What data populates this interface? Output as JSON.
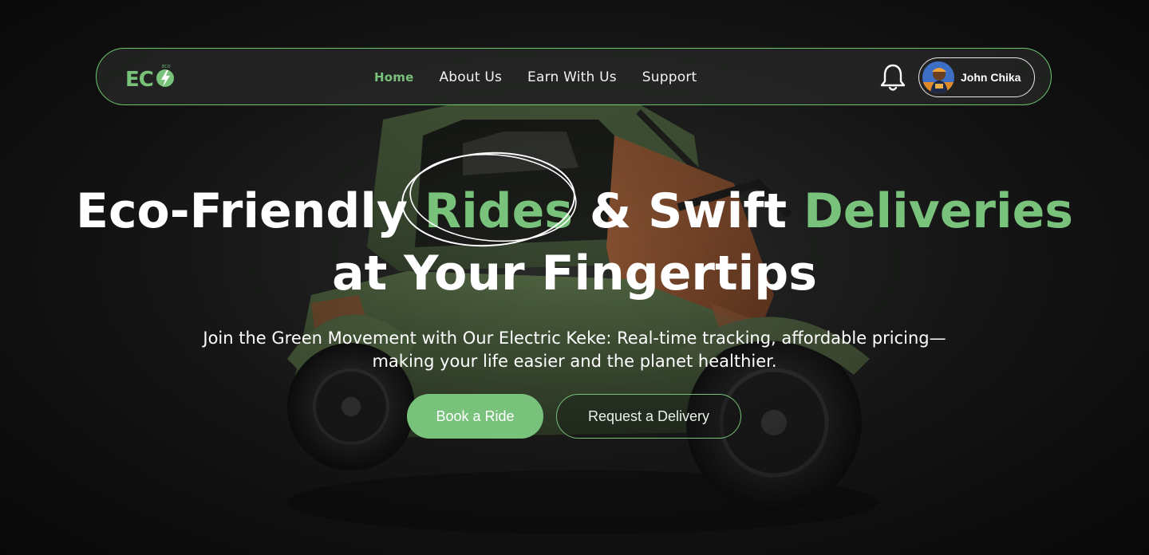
{
  "brand": {
    "logo_text": "ECO",
    "logo_icon": "lightning-bolt-icon",
    "accent_color": "#78c27b"
  },
  "nav": {
    "items": [
      {
        "label": "Home",
        "active": true
      },
      {
        "label": "About Us",
        "active": false
      },
      {
        "label": "Earn With Us",
        "active": false
      },
      {
        "label": "Support",
        "active": false
      }
    ]
  },
  "header_actions": {
    "notification_icon": "bell-icon",
    "user_name": "John Chika"
  },
  "hero": {
    "title_part1": "Eco-Friendly ",
    "title_highlight1": "Rides",
    "title_part2": " & Swift ",
    "title_highlight2": "Deliveries",
    "title_line2": "at Your Fingertips",
    "subtitle_line1": "Join the Green Movement with Our Electric Keke: Real-time tracking, affordable pricing—",
    "subtitle_line2": "making your life easier and the planet healthier.",
    "primary_cta": "Book a Ride",
    "secondary_cta": "Request a Delivery"
  }
}
